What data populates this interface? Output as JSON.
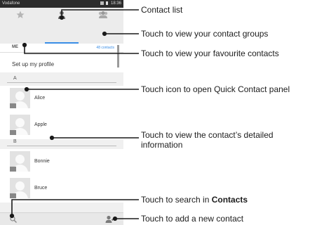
{
  "status_bar": {
    "carrier": "Vodafone",
    "time": "18:36"
  },
  "tabs": [
    {
      "icon": "star-icon",
      "selected": false
    },
    {
      "icon": "person-icon",
      "selected": true
    },
    {
      "icon": "group-icon",
      "selected": false
    }
  ],
  "list": {
    "me_header": "ME",
    "contact_count": "48 contacts",
    "profile_setup": "Set up my profile",
    "sections": [
      {
        "letter": "A",
        "contacts": [
          "Alice",
          "Apple"
        ]
      },
      {
        "letter": "B",
        "contacts": [
          "Bonnie",
          "Bruce"
        ]
      }
    ]
  },
  "bottom_bar": {
    "left_icon": "search-icon",
    "right_icon": "add-contact-icon"
  },
  "annotations": {
    "contact_list": "Contact list",
    "groups": "Touch to view your contact groups",
    "favourites": "Touch to view your favourite contacts",
    "quick_contact": "Touch icon to open Quick Contact panel",
    "details": "Touch to view the contact’s detailed information",
    "search_prefix": "Touch to search in ",
    "search_bold": "Contacts",
    "add_contact": "Touch to add a new contact"
  },
  "colors": {
    "accent": "#3a8ee6",
    "status_bar": "#2c2c2c"
  }
}
